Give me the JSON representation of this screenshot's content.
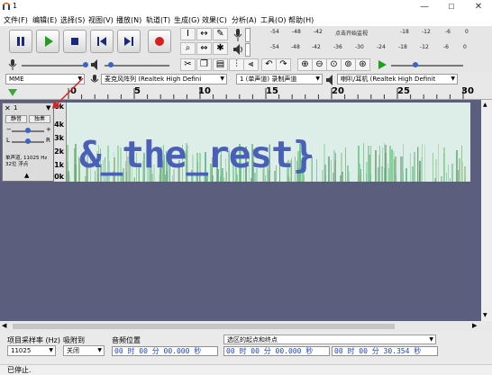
{
  "window": {
    "title": "1",
    "min": "—",
    "max": "☐",
    "close": "✕"
  },
  "menu": [
    "文件(F)",
    "编辑(E)",
    "选择(S)",
    "视图(V)",
    "播放(N)",
    "轨道(T)",
    "生成(G)",
    "效果(C)",
    "分析(A)",
    "工具(O)",
    "帮助(H)"
  ],
  "meter": {
    "ticks": [
      "-54",
      "-48",
      "-42",
      "-18",
      "-12",
      "-6",
      "0"
    ],
    "click_text": "点击开始监视",
    "ticks2": [
      "-54",
      "-48",
      "-42",
      "-36",
      "-30",
      "-24",
      "-18",
      "-12",
      "-6",
      "0"
    ]
  },
  "devices": {
    "host": "MME",
    "recording_device": "麦克风阵列 (Realtek High Defini",
    "channels": "1 (单声道) 录制声道",
    "playback_device": "喇叭/耳机 (Realtek High Definit"
  },
  "ruler": [
    "0",
    "5",
    "10",
    "15",
    "20",
    "25",
    "30"
  ],
  "track": {
    "name": "1",
    "mute": "静音",
    "solo": "独奏",
    "info": "单声道, 11025 Hz\n32位 浮点",
    "scale": [
      "6k",
      "4k",
      "3k",
      "2k",
      "1k",
      "0k"
    ],
    "spectro_text": "&_the_rest}"
  },
  "selection_bar": {
    "rate_label": "项目采样率 (Hz)",
    "rate_value": "11025",
    "snap_label": "吸附到",
    "snap_value": "关闭",
    "audio_pos_label": "音频位置",
    "audio_pos_value": "00 时 00 分 00.000 秒",
    "sel_label": "选区的起点和终点",
    "sel_start": "00 时 00 分 00.000 秒",
    "sel_end": "00 时 00 分 30.354 秒"
  },
  "status": "已停止.",
  "colors": {
    "play": "#20a020",
    "record": "#d42020",
    "spectro_text": "#4a5fb8"
  }
}
